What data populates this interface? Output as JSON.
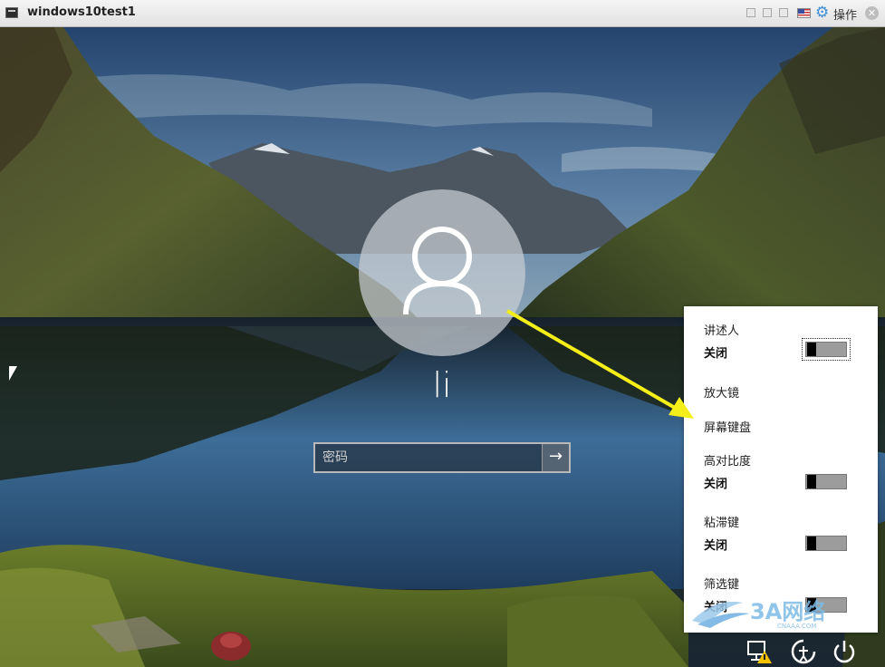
{
  "window": {
    "title": "windows10test1",
    "operations_label": "操作",
    "icons": [
      "app-console-icon",
      "window-mode-icon",
      "restore-icon",
      "maximize-icon",
      "us-flag-icon",
      "gear-icon",
      "close-icon"
    ]
  },
  "login": {
    "username": "li",
    "password_placeholder": "密码",
    "submit_icon": "arrow-right-icon"
  },
  "ease_of_access": {
    "items": [
      {
        "label": "讲述人",
        "state": "关闭",
        "toggle": true
      },
      {
        "label": "放大镜"
      },
      {
        "label": "屏幕键盘"
      },
      {
        "label": "高对比度",
        "state": "关闭",
        "toggle": true
      },
      {
        "label": "粘滞键",
        "state": "关闭",
        "toggle": true
      },
      {
        "label": "筛选键",
        "state": "关闭",
        "toggle": true
      }
    ]
  },
  "system_icons": [
    "network-warning-icon",
    "ease-of-access-icon",
    "power-icon"
  ],
  "annotation": {
    "arrow_color": "#f5ef19"
  },
  "watermark": {
    "text": "3A网络",
    "subtext": "CNAAA.COM"
  }
}
